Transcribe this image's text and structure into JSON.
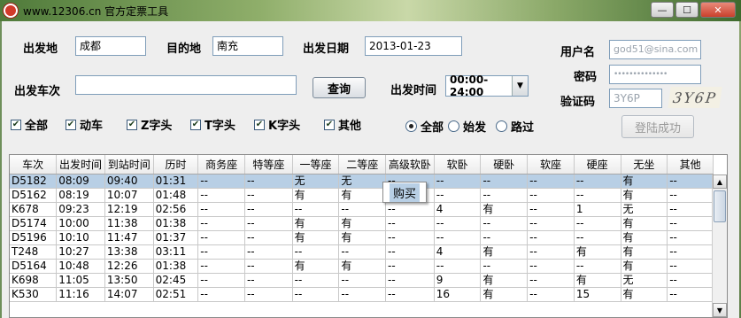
{
  "window": {
    "title": "www.12306.cn 官方定票工具",
    "minimize_glyph": "—",
    "maximize_glyph": "☐",
    "close_glyph": "✕"
  },
  "form": {
    "from_label": "出发地",
    "from_value": "成都",
    "to_label": "目的地",
    "to_value": "南充",
    "date_label": "出发日期",
    "date_value": "2013-01-23",
    "train_label": "出发车次",
    "train_value": "",
    "search_button": "查询",
    "time_label": "出发时间",
    "time_value": "00:00-24:00"
  },
  "login": {
    "user_label": "用户名",
    "user_value": "god51@sina.com",
    "password_label": "密码",
    "password_value": "••••••••••••••",
    "captcha_label": "验证码",
    "captcha_input": "3Y6P",
    "captcha_image_text": "3Y6P",
    "login_button": "登陆成功"
  },
  "filters": {
    "train_types": [
      {
        "label": "全部",
        "checked": true
      },
      {
        "label": "动车",
        "checked": true
      },
      {
        "label": "Z字头",
        "checked": true
      },
      {
        "label": "T字头",
        "checked": true
      },
      {
        "label": "K字头",
        "checked": true
      },
      {
        "label": "其他",
        "checked": true
      }
    ],
    "check_glyph": "✔",
    "station_types": [
      {
        "label": "全部",
        "selected": true
      },
      {
        "label": "始发",
        "selected": false
      },
      {
        "label": "路过",
        "selected": false
      }
    ]
  },
  "table": {
    "columns": [
      "车次",
      "出发时间",
      "到站时间",
      "历时",
      "商务座",
      "特等座",
      "一等座",
      "二等座",
      "高级软卧",
      "软卧",
      "硬卧",
      "软座",
      "硬座",
      "无坐",
      "其他"
    ],
    "rows": [
      [
        "D5182",
        "08:09",
        "09:40",
        "01:31",
        "--",
        "--",
        "无",
        "无",
        "--",
        "--",
        "--",
        "--",
        "--",
        "有",
        "--"
      ],
      [
        "D5162",
        "08:19",
        "10:07",
        "01:48",
        "--",
        "--",
        "有",
        "有",
        "--",
        "--",
        "--",
        "--",
        "--",
        "有",
        "--"
      ],
      [
        "K678",
        "09:23",
        "12:19",
        "02:56",
        "--",
        "--",
        "--",
        "--",
        "--",
        "4",
        "有",
        "--",
        "1",
        "无",
        "--"
      ],
      [
        "D5174",
        "10:00",
        "11:38",
        "01:38",
        "--",
        "--",
        "有",
        "有",
        "--",
        "--",
        "--",
        "--",
        "--",
        "有",
        "--"
      ],
      [
        "D5196",
        "10:10",
        "11:47",
        "01:37",
        "--",
        "--",
        "有",
        "有",
        "--",
        "--",
        "--",
        "--",
        "--",
        "有",
        "--"
      ],
      [
        "T248",
        "10:27",
        "13:38",
        "03:11",
        "--",
        "--",
        "--",
        "--",
        "--",
        "4",
        "有",
        "--",
        "有",
        "有",
        "--"
      ],
      [
        "D5164",
        "10:48",
        "12:26",
        "01:38",
        "--",
        "--",
        "有",
        "有",
        "--",
        "--",
        "--",
        "--",
        "--",
        "有",
        "--"
      ],
      [
        "K698",
        "11:05",
        "13:50",
        "02:45",
        "--",
        "--",
        "--",
        "--",
        "--",
        "9",
        "有",
        "--",
        "有",
        "无",
        "--"
      ],
      [
        "K530",
        "11:16",
        "14:07",
        "02:51",
        "--",
        "--",
        "--",
        "--",
        "--",
        "16",
        "有",
        "--",
        "15",
        "有",
        "--"
      ]
    ],
    "selected_row": 0,
    "context_menu_item": "购买"
  },
  "colors": {
    "selection": "#b8cfe5",
    "window_bg": "#eeeeee",
    "titlebar": "#6e8f5a"
  },
  "icons": {
    "app": "railway-logo-icon",
    "dropdown": "chevron-down-icon",
    "scroll_up": "arrow-up-icon",
    "scroll_down": "arrow-down-icon"
  }
}
